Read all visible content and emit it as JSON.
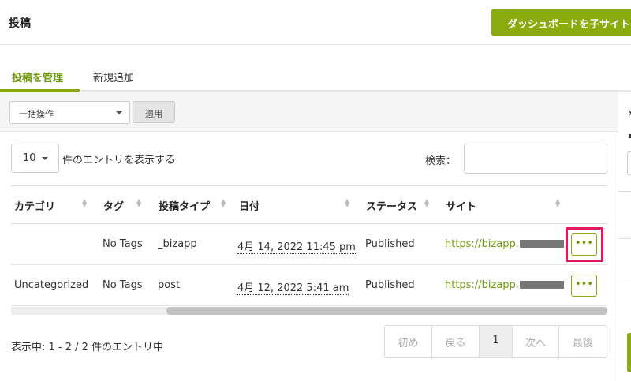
{
  "header": {
    "title": "投稿",
    "dashboard_button": "ダッシュボードを子サイト"
  },
  "tabs": [
    {
      "label": "投稿を管理",
      "active": true
    },
    {
      "label": "新規追加",
      "active": false
    }
  ],
  "bulk": {
    "selected": "一括操作",
    "apply_label": "適用"
  },
  "table_controls": {
    "length_value": "10",
    "length_label": "件のエントリを表示する",
    "search_label": "検索：",
    "search_value": ""
  },
  "columns": [
    "カテゴリ",
    "タグ",
    "投稿タイプ",
    "日付",
    "ステータス",
    "サイト"
  ],
  "rows": [
    {
      "category": "",
      "tags": "No Tags",
      "post_type": "_bizapp",
      "date": "4月 14, 2022 11:45 pm",
      "status": "Published",
      "site": "https://bizapp.",
      "action": "•••"
    },
    {
      "category": "Uncategorized",
      "tags": "No Tags",
      "post_type": "post",
      "date": "4月 12, 2022 5:41 am",
      "status": "Published",
      "site": "https://bizapp.",
      "action": "•••"
    }
  ],
  "footer": {
    "info": "表示中: 1 - 2 / 2 件のエントリ中",
    "pagination": {
      "first": "初め",
      "prev": "戻る",
      "current": "1",
      "next": "次へ",
      "last": "最後"
    }
  },
  "colors": {
    "accent": "#8aab0b",
    "link": "#6f9a0c",
    "highlight": "#e2195e"
  }
}
